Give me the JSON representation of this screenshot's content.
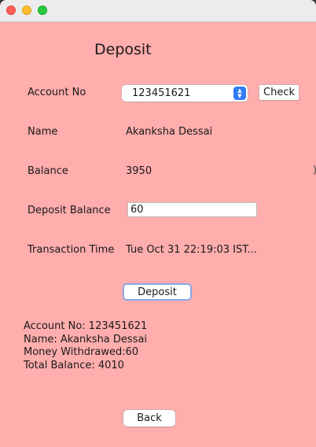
{
  "window": {
    "background": "#ffadad"
  },
  "heading": "Deposit",
  "account": {
    "label": "Account No",
    "selected": "123451621",
    "check_label": "Check"
  },
  "name": {
    "label": "Name",
    "value": "Akanksha Dessai"
  },
  "balance": {
    "label": "Balance",
    "value": "3950"
  },
  "deposit": {
    "label": "Deposit Balance",
    "input_value": "60"
  },
  "transaction": {
    "label": "Transaction Time",
    "value": "Tue Oct 31 22:19:03 IST..."
  },
  "deposit_button_label": "Deposit",
  "summary": {
    "line1": "Account No: 123451621",
    "line2": "Name: Akanksha Dessai",
    "line3": "Money Withdrawed:60",
    "line4": "Total Balance: 4010"
  },
  "back_button_label": "Back"
}
